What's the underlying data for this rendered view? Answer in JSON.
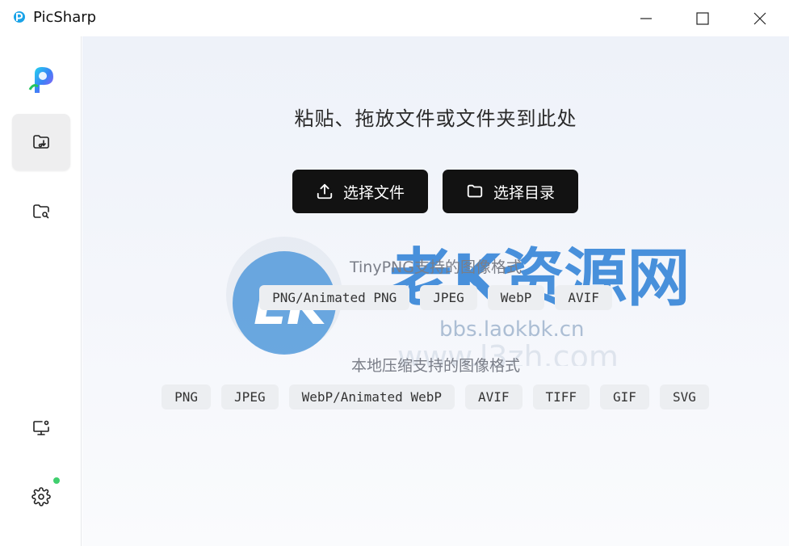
{
  "window": {
    "title": "PicSharp",
    "controls": [
      "minimize-icon",
      "maximize-icon",
      "close-icon"
    ]
  },
  "sidebar": {
    "items": [
      {
        "name": "compress",
        "icon": "folder-download-icon",
        "active": true
      },
      {
        "name": "watch",
        "icon": "folder-search-icon",
        "active": false
      },
      {
        "name": "monitor",
        "icon": "monitor-settings-icon",
        "active": false
      },
      {
        "name": "settings",
        "icon": "gear-icon",
        "active": false,
        "badge_color": "#3fcf6e"
      }
    ]
  },
  "main": {
    "drop_title": "粘贴、拖放文件或文件夹到此处",
    "buttons": {
      "select_files": "选择文件",
      "select_dir": "选择目录"
    },
    "tinypng": {
      "title": "TinyPNG支持的图像格式",
      "formats": [
        "PNG/Animated PNG",
        "JPEG",
        "WebP",
        "AVIF"
      ]
    },
    "local": {
      "title": "本地压缩支持的图像格式",
      "formats": [
        "PNG",
        "JPEG",
        "WebP/Animated WebP",
        "AVIF",
        "TIFF",
        "GIF",
        "SVG"
      ]
    }
  },
  "watermark": {
    "logo_text": "LK",
    "site_name": "老K资源网",
    "url_1": "bbs.laokbk.cn",
    "url_2": "www.l3zh.com"
  },
  "colors": {
    "button_bg": "#121212",
    "chip_bg": "#eceef1",
    "status_dot": "#3fcf6e"
  }
}
